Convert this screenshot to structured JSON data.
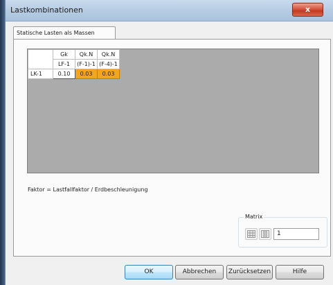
{
  "window": {
    "title": "Lastkombinationen",
    "close_glyph": "x"
  },
  "tabs": [
    {
      "label": "Statische Lasten als Massen",
      "selected": true
    }
  ],
  "grid": {
    "columns": [
      {
        "top": "Gk",
        "bottom": "LF-1"
      },
      {
        "top": "Qk.N",
        "bottom": "(F-1)-1"
      },
      {
        "top": "Qk.N",
        "bottom": "(F-4)-1"
      }
    ],
    "rows": [
      {
        "label": "LK-1",
        "values": [
          "0.10",
          "0.03",
          "0.03"
        ],
        "highlight": [
          false,
          true,
          true
        ]
      }
    ],
    "highlight_color": "#f3a51d"
  },
  "note": "Faktor = Lastfallfaktor / Erdbeschleunigung",
  "matrix": {
    "label": "Matrix",
    "value": "1",
    "icons": [
      "matrix-grid-icon",
      "matrix-columns-icon"
    ]
  },
  "buttons": {
    "ok": "OK",
    "cancel": "Abbrechen",
    "reset": "Zurücksetzen",
    "help": "Hilfe"
  }
}
